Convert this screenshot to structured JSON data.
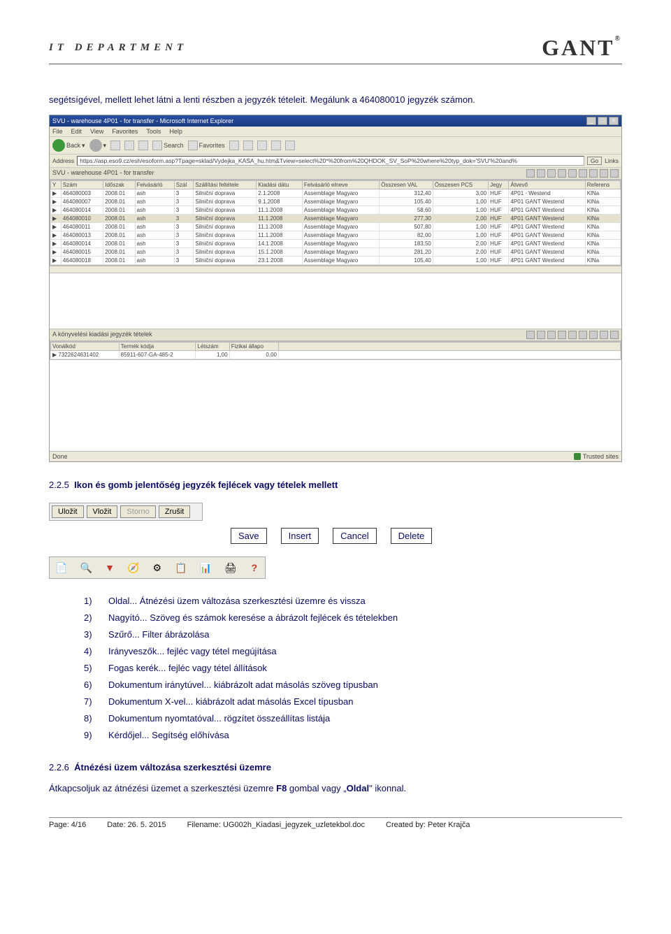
{
  "header": {
    "left": "IT DEPARTMENT",
    "right": "GANT"
  },
  "intro": "segétsígével, mellett lehet látni a lenti részben a jegyzék tételeit. Megálunk a 464080010 jegyzék számon.",
  "ie": {
    "title": "SVU - warehouse 4P01 - for transfer - Microsoft Internet Explorer",
    "menu": [
      "File",
      "Edit",
      "View",
      "Favorites",
      "Tools",
      "Help"
    ],
    "toolbar": {
      "back": "Back",
      "search": "Search",
      "favorites": "Favorites"
    },
    "addressLabel": "Address",
    "addressValue": "https://asp.eso9.cz/esh/esoform.asp?Tpage=sklad/Vydejka_KASA_hu.htm&Tview=select%20*%20from%20QHDOK_SV_SoP%20where%20typ_dok='SVU'%20and%",
    "go": "Go",
    "links": "Links",
    "subTitle": "SVU - warehouse 4P01 - for transfer",
    "status": {
      "done": "Done",
      "trusted": "Trusted sites"
    }
  },
  "gridHeaders": [
    "Y",
    "Szám",
    "Időszak",
    "Felvásárló",
    "Szál",
    "Szállítási feltétele",
    "Kiadási dátu",
    "Felvásárló elneve",
    "Összesen VAL",
    "Összesen PCS",
    "Jegy",
    "Átvevő",
    "Referens"
  ],
  "gridRows": [
    {
      "szam": "464080003",
      "idoszak": "2008.01",
      "felv": "ash",
      "szal": "3",
      "felt": "Silniční doprava",
      "datum": "2.1.2008",
      "elnev": "Assemblage Magyaro",
      "val": "312,40",
      "pcs": "3,00",
      "jegy": "HUF",
      "atvevo": "4P01 - Westend",
      "ref": "KlNa"
    },
    {
      "szam": "464080007",
      "idoszak": "2008.01",
      "felv": "ash",
      "szal": "3",
      "felt": "Silniční doprava",
      "datum": "9.1.2008",
      "elnev": "Assemblage Magyaro",
      "val": "105,40",
      "pcs": "1,00",
      "jegy": "HUF",
      "atvevo": "4P01 GANT Westend",
      "ref": "KlNa"
    },
    {
      "szam": "464080014",
      "idoszak": "2008.01",
      "felv": "ash",
      "szal": "3",
      "felt": "Silniční doprava",
      "datum": "11.1.2008",
      "elnev": "Assemblage Magyaro",
      "val": "58,60",
      "pcs": "1,00",
      "jegy": "HUF",
      "atvevo": "4P01 GANT Westend",
      "ref": "KlNa"
    },
    {
      "szam": "464080010",
      "idoszak": "2008.01",
      "felv": "ash",
      "szal": "3",
      "felt": "Silniční doprava",
      "datum": "11.1.2008",
      "elnev": "Assemblage Magyaro",
      "val": "277,30",
      "pcs": "2,00",
      "jegy": "HUF",
      "atvevo": "4P01 GANT Westend",
      "ref": "KlNa",
      "sel": true
    },
    {
      "szam": "464080011",
      "idoszak": "2008.01",
      "felv": "ash",
      "szal": "3",
      "felt": "Silniční doprava",
      "datum": "11.1.2008",
      "elnev": "Assemblage Magyaro",
      "val": "507,80",
      "pcs": "1,00",
      "jegy": "HUF",
      "atvevo": "4P01 GANT Westend",
      "ref": "KlNa"
    },
    {
      "szam": "464080013",
      "idoszak": "2008.01",
      "felv": "ash",
      "szal": "3",
      "felt": "Silniční doprava",
      "datum": "11.1.2008",
      "elnev": "Assemblage Magyaro",
      "val": "82,00",
      "pcs": "1,00",
      "jegy": "HUF",
      "atvevo": "4P01 GANT Westend",
      "ref": "KlNa"
    },
    {
      "szam": "464080014",
      "idoszak": "2008.01",
      "felv": "ash",
      "szal": "3",
      "felt": "Silniční doprava",
      "datum": "14.1.2008",
      "elnev": "Assemblage Magyaro",
      "val": "183,50",
      "pcs": "2,00",
      "jegy": "HUF",
      "atvevo": "4P01 GANT Westend",
      "ref": "KlNa"
    },
    {
      "szam": "464080015",
      "idoszak": "2008.01",
      "felv": "ash",
      "szal": "3",
      "felt": "Silniční doprava",
      "datum": "15.1.2008",
      "elnev": "Assemblage Magyaro",
      "val": "281,20",
      "pcs": "2,00",
      "jegy": "HUF",
      "atvevo": "4P01 GANT Westend",
      "ref": "KlNa"
    },
    {
      "szam": "464080018",
      "idoszak": "2008.01",
      "felv": "ash",
      "szal": "3",
      "felt": "Silniční doprava",
      "datum": "23.1.2008",
      "elnev": "Assemblage Magyaro",
      "val": "105,40",
      "pcs": "1,00",
      "jegy": "HUF",
      "atvevo": "4P01 GANT Westend",
      "ref": "KlNa"
    }
  ],
  "detailTitle": "A könyvelési kiadási jegyzék tételek",
  "detailHeaders": [
    "Vonálkód",
    "Termék kódja",
    "Létszám",
    "Fizikai állapo"
  ],
  "detailRow": {
    "vonalkod": "7322624631402",
    "termek": "85911-607-GA-485-2",
    "letszam": "1,00",
    "fizikai": "0,00"
  },
  "sec225": {
    "num": "2.2.5",
    "title": "Ikon és gomb jelentőség jegyzék fejlécek vagy tételek mellett"
  },
  "czButtons": [
    "Uložit",
    "Vložit",
    "Storno",
    "Zrušit"
  ],
  "enLabels": [
    "Save",
    "Insert",
    "Cancel",
    "Delete"
  ],
  "list": [
    {
      "n": "1)",
      "t": "Oldal... Átnézési üzem változása szerkesztési üzemre és vissza"
    },
    {
      "n": "2)",
      "t": "Nagyító... Szöveg és számok keresése a ábrázolt fejlécek és tételekben"
    },
    {
      "n": "3)",
      "t": "Szűrő... Filter ábrázolása"
    },
    {
      "n": "4)",
      "t": "Irányveszők... fejléc vagy tétel megújítása"
    },
    {
      "n": "5)",
      "t": "Fogas kerék... fejléc vagy tétel állítások"
    },
    {
      "n": "6)",
      "t": "Dokumentum iránytúvel... kiábrázolt adat másolás szöveg típusban"
    },
    {
      "n": "7)",
      "t": "Dokumentum X-vel... kiábrázolt adat másolás Excel típusban"
    },
    {
      "n": "8)",
      "t": "Dokumentum nyomtatóval... rögzítet összeállítas listája"
    },
    {
      "n": "9)",
      "t": "Kérdőjel... Segítség előhívása"
    }
  ],
  "sec226": {
    "num": "2.2.6",
    "title": "Átnézési üzem változása szerkesztési üzemre",
    "body": "Átkapcsoljuk az átnézési üzemet a szerkesztési üzemre F8 gombal vagy „Oldal\" ikonnal."
  },
  "footer": {
    "page": "Page: 4/16",
    "date": "Date: 26. 5. 2015",
    "file": "Filename: UG002h_Kiadasi_jegyzek_uzletekbol.doc",
    "created": "Created by: Peter Krajča"
  }
}
